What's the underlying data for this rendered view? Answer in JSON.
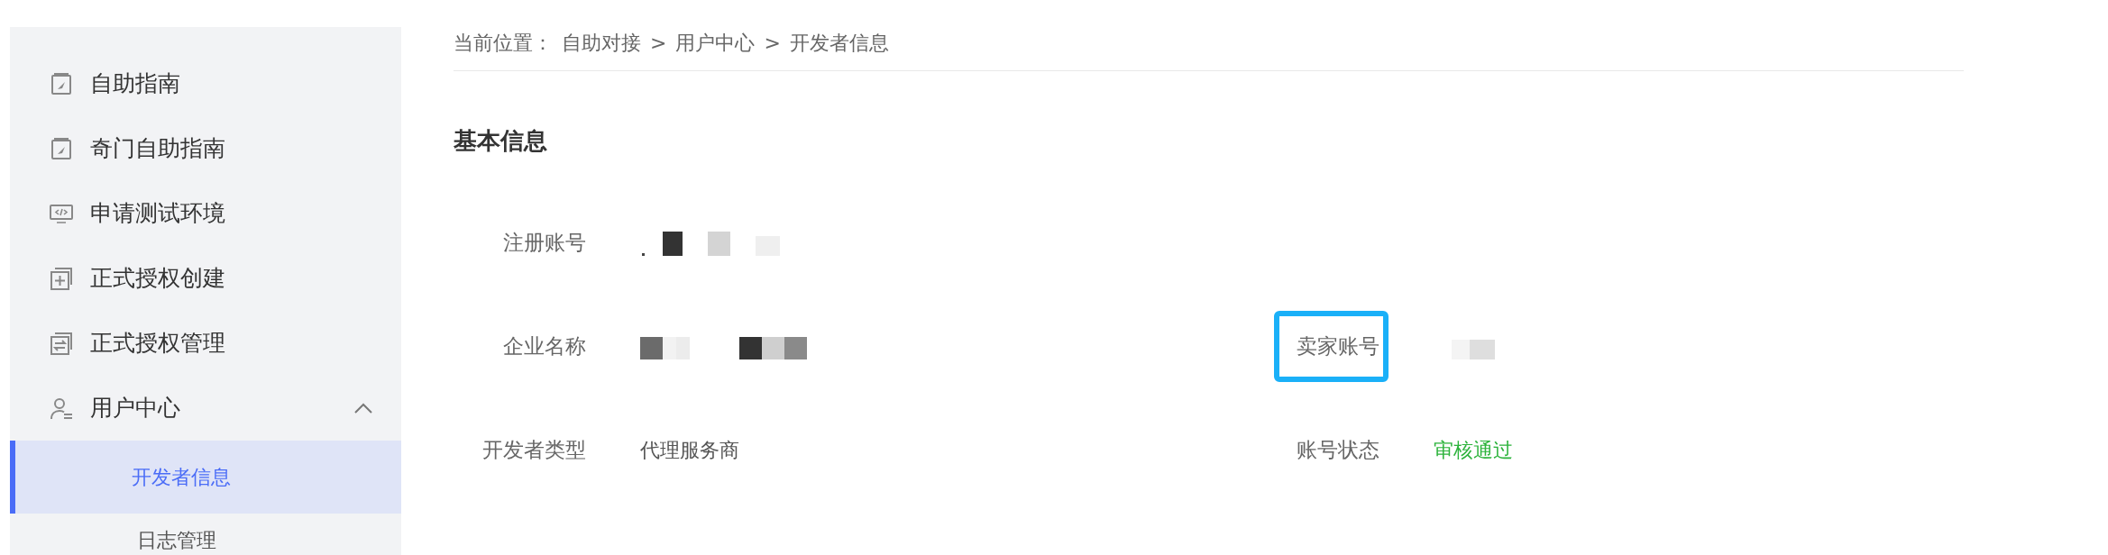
{
  "sidebar": {
    "items": [
      {
        "label": "自助指南"
      },
      {
        "label": "奇门自助指南"
      },
      {
        "label": "申请测试环境"
      },
      {
        "label": "正式授权创建"
      },
      {
        "label": "正式授权管理"
      },
      {
        "label": "用户中心",
        "expanded": true,
        "children": [
          {
            "label": "开发者信息",
            "selected": true
          },
          {
            "label": "日志管理",
            "selected": false
          }
        ]
      }
    ]
  },
  "breadcrumb": {
    "prefix": "当前位置：",
    "path": [
      "自助对接",
      "用户中心",
      "开发者信息"
    ],
    "separator": ">"
  },
  "section": {
    "title": "基本信息"
  },
  "rows": [
    [
      {
        "label": "注册账号",
        "redacted": true
      }
    ],
    [
      {
        "label": "企业名称",
        "redacted": true
      },
      {
        "label": "卖家账号",
        "redacted": true,
        "highlighted": true
      }
    ],
    [
      {
        "label": "开发者类型",
        "value": "代理服务商",
        "kind": "text"
      },
      {
        "label": "账号状态",
        "value": "审核通过",
        "kind": "status"
      }
    ]
  ]
}
